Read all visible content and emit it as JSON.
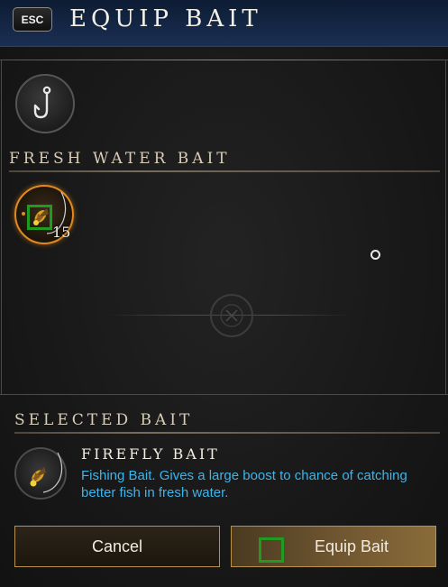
{
  "header": {
    "esc_label": "ESC",
    "title": "EQUIP BAIT"
  },
  "bait_list": {
    "section_title": "FRESH WATER BAIT",
    "items": [
      {
        "name": "Firefly Bait",
        "count": "15",
        "selected": true
      }
    ]
  },
  "selected": {
    "section_title": "SELECTED BAIT",
    "name": "FIREFLY BAIT",
    "description": "Fishing Bait. Gives a large boost to chance of catching better fish in fresh water."
  },
  "buttons": {
    "cancel_label": "Cancel",
    "equip_label": "Equip Bait"
  },
  "colors": {
    "accent_orange": "#e38a1e",
    "description_blue": "#3db4ea",
    "button_border": "#b8914c",
    "header_blue": "#16294a"
  },
  "icons": {
    "hook": "fishing-hook-icon",
    "bait": "firefly-bait-icon",
    "emblem": "divider-emblem-icon"
  }
}
